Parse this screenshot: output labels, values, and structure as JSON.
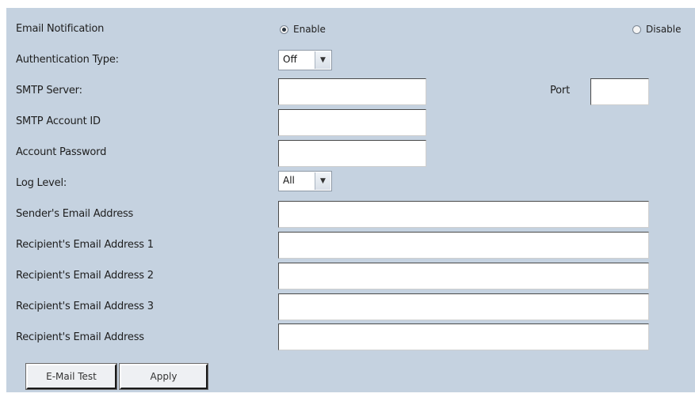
{
  "form": {
    "rows": [
      {
        "label": "Email Notification"
      },
      {
        "label": "Authentication Type:"
      },
      {
        "label": "SMTP Server:"
      },
      {
        "label": "SMTP Account ID"
      },
      {
        "label": "Account Password"
      },
      {
        "label": "Log Level:"
      },
      {
        "label": "Sender's Email Address"
      },
      {
        "label": "Recipient's Email Address 1"
      },
      {
        "label": "Recipient's Email Address 2"
      },
      {
        "label": "Recipient's Email Address 3"
      },
      {
        "label": "Recipient's Email Address"
      }
    ],
    "notification": {
      "enable_label": "Enable",
      "disable_label": "Disable",
      "selected": "enable"
    },
    "auth_type": {
      "value": "Off"
    },
    "smtp_server": {
      "value": ""
    },
    "port": {
      "label": "Port",
      "value": ""
    },
    "smtp_account_id": {
      "value": ""
    },
    "account_password": {
      "value": ""
    },
    "log_level": {
      "value": "All"
    },
    "sender_email": {
      "value": ""
    },
    "recipient_1": {
      "value": ""
    },
    "recipient_2": {
      "value": ""
    },
    "recipient_3": {
      "value": ""
    },
    "recipient_4": {
      "value": ""
    }
  },
  "buttons": {
    "test_label": "E-Mail Test",
    "apply_label": "Apply"
  }
}
